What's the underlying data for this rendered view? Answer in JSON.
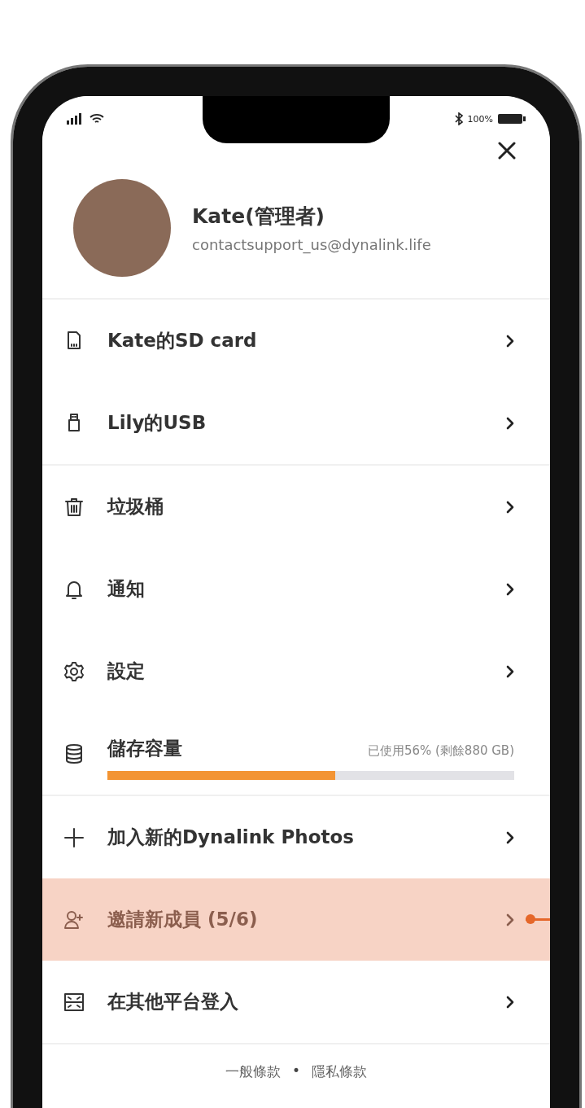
{
  "status_bar": {
    "battery_text": "100%"
  },
  "profile": {
    "name": "Kate(管理者)",
    "email": "contactsupport_us@dynalink.life"
  },
  "sections": [
    {
      "items": [
        {
          "kind": "link",
          "label": "Kate的SD card",
          "selected": false
        },
        {
          "kind": "link",
          "label": "Lily的USB",
          "selected": false
        }
      ]
    },
    {
      "items": [
        {
          "kind": "link",
          "label": "垃圾桶",
          "selected": false
        },
        {
          "kind": "link",
          "label": "通知",
          "selected": false
        },
        {
          "kind": "link",
          "label": "設定",
          "selected": false
        },
        {
          "kind": "storage",
          "label": "儲存容量",
          "reading": "已使用56% (剩餘880 GB)",
          "level": 0.56
        }
      ]
    },
    {
      "items": [
        {
          "kind": "link",
          "label": "加入新的Dynalink Photos",
          "selected": false
        },
        {
          "kind": "link",
          "label": "邀請新成員 (5/6)",
          "selected": true
        },
        {
          "kind": "link",
          "label": "在其他平台登入",
          "selected": false
        }
      ]
    }
  ],
  "footer": {
    "links": [
      "一般條款",
      "隱私條款"
    ],
    "separator": "•"
  }
}
